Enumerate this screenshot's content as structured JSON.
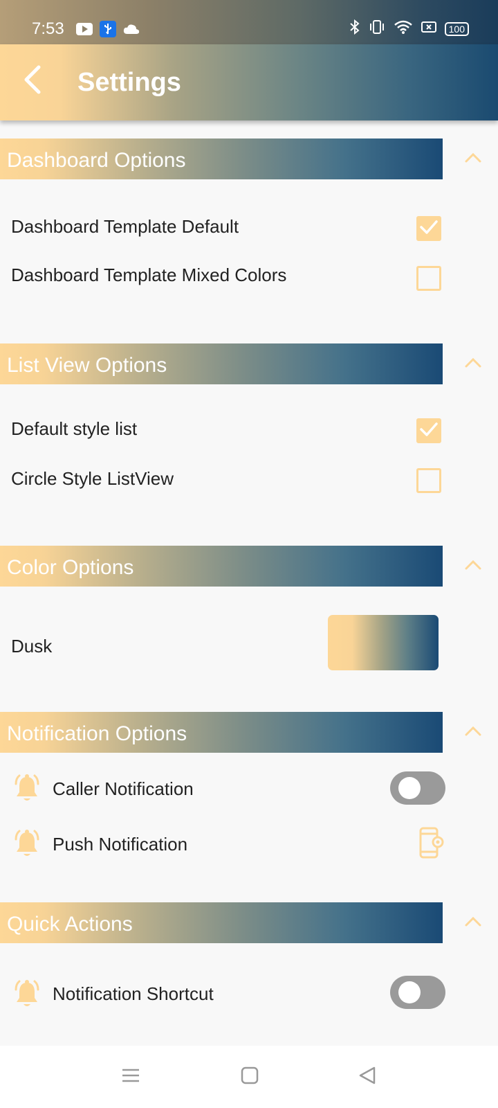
{
  "status_bar": {
    "time": "7:53",
    "left_icons": [
      "youtube-icon",
      "usb-icon",
      "cloud-icon"
    ],
    "right_icons": [
      "bluetooth-icon",
      "vibrate-icon",
      "wifi-icon",
      "screen-icon",
      "battery-icon"
    ],
    "battery": "100"
  },
  "app_bar": {
    "title": "Settings",
    "back_icon": "chevron-left-icon"
  },
  "sections": {
    "dashboard": {
      "title": "Dashboard Options",
      "items": [
        {
          "label": "Dashboard Template Default",
          "checked": true
        },
        {
          "label": "Dashboard Template Mixed Colors",
          "checked": false
        }
      ]
    },
    "list_view": {
      "title": "List View Options",
      "items": [
        {
          "label": "Default style list",
          "checked": true
        },
        {
          "label": "Circle Style ListView",
          "checked": false
        }
      ]
    },
    "color": {
      "title": "Color Options",
      "selected_label": "Dusk"
    },
    "notification": {
      "title": "Notification Options",
      "items": [
        {
          "label": "Caller Notification",
          "control": "toggle",
          "on": false
        },
        {
          "label": "Push Notification",
          "control": "phone-settings-icon"
        }
      ]
    },
    "quick_actions": {
      "title": "Quick Actions",
      "items": [
        {
          "label": "Notification Shortcut",
          "control": "toggle",
          "on": false
        }
      ]
    }
  },
  "nav_bar": {
    "buttons": [
      "menu-icon",
      "home-square-icon",
      "back-triangle-icon"
    ]
  },
  "colors": {
    "accent": "#fdd797",
    "gradient_end": "#1a4a75",
    "toggle_off": "#9a9a9a"
  }
}
